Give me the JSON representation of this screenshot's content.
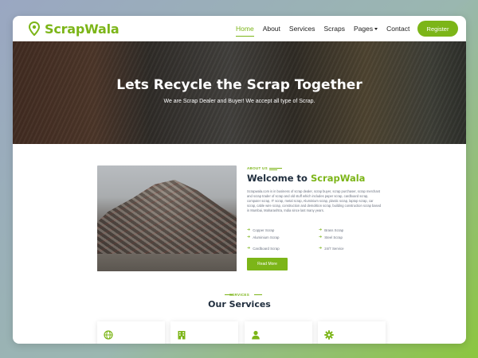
{
  "brand": {
    "name": "ScrapWala",
    "accent_color": "#7cb518"
  },
  "nav": {
    "items": [
      {
        "label": "Home",
        "active": true
      },
      {
        "label": "About"
      },
      {
        "label": "Services"
      },
      {
        "label": "Scraps"
      },
      {
        "label": "Pages",
        "dropdown": true
      },
      {
        "label": "Contact"
      }
    ],
    "register_label": "Register"
  },
  "hero": {
    "title": "Lets Recycle the Scrap Together",
    "subtitle": "We are Scrap Dealer and Buyer! We accept all type of Scrap."
  },
  "about": {
    "eyebrow": "ABOUT US",
    "title_prefix": "Welcome to",
    "title_brand": "ScrapWala",
    "description": "Scrapwala.com is in business of scrap dealer, scrap buyer, scrap purchaser, scrap merchant and scrap trader of scrap and old stuff which includes paper scrap, cardboard scrap, computer scrap, IT scrap, metal scrap, Aluminium scrap, plastic scrap, laptop scrap, car scrap, cable wire scrap, construction and demolition scrap, building construction scrap based in Mumbai, Maharashtra, India since last many years.",
    "features": [
      "Copper Scrap",
      "Brass Scrap",
      "Aluminium Scrap",
      "Steel Scrap",
      "",
      "",
      "Cardboard Scrap",
      "24/7 Service"
    ],
    "read_more_label": "Read More"
  },
  "services": {
    "eyebrow": "SERVICES",
    "title": "Our Services",
    "cards": [
      {
        "icon": "globe-icon"
      },
      {
        "icon": "building-icon"
      },
      {
        "icon": "user-icon"
      },
      {
        "icon": "gear-icon"
      }
    ]
  }
}
